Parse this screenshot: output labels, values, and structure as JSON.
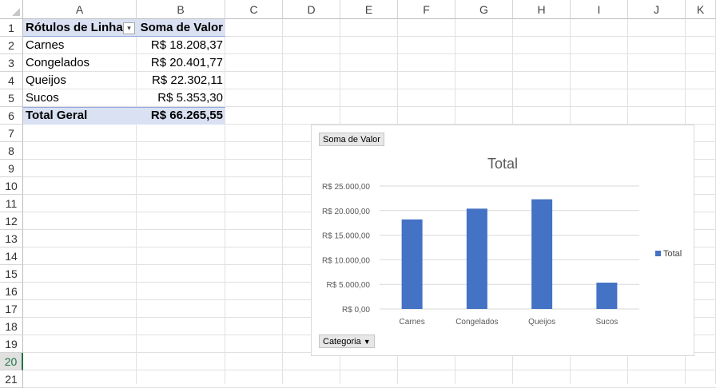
{
  "columns": [
    "A",
    "B",
    "C",
    "D",
    "E",
    "F",
    "G",
    "H",
    "I",
    "J",
    "K"
  ],
  "rows": [
    "1",
    "2",
    "3",
    "4",
    "5",
    "6",
    "7",
    "8",
    "9",
    "10",
    "11",
    "12",
    "13",
    "14",
    "15",
    "16",
    "17",
    "18",
    "19",
    "20",
    "21"
  ],
  "selected_row": "20",
  "pivot": {
    "header_label": "Rótulos de Linha",
    "header_value": "Soma de Valor",
    "items": [
      {
        "label": "Carnes",
        "value": "R$ 18.208,37"
      },
      {
        "label": "Congelados",
        "value": "R$ 20.401,77"
      },
      {
        "label": "Queijos",
        "value": "R$ 22.302,11"
      },
      {
        "label": "Sucos",
        "value": "R$ 5.353,30"
      }
    ],
    "total_label": "Total Geral",
    "total_value": "R$ 66.265,55",
    "filter_icon": "dropdown-arrow-icon"
  },
  "chart": {
    "value_field_button": "Soma de Valor",
    "axis_field_button": "Categoria",
    "colors": {
      "bar": "#4472c4",
      "grid": "#d9d9d9"
    }
  },
  "chart_data": {
    "type": "bar",
    "title": "Total",
    "categories": [
      "Carnes",
      "Congelados",
      "Queijos",
      "Sucos"
    ],
    "series": [
      {
        "name": "Total",
        "values": [
          18208.37,
          20401.77,
          22302.11,
          5353.3
        ]
      }
    ],
    "ylim": [
      0,
      25000
    ],
    "yticks": [
      0,
      5000,
      10000,
      15000,
      20000,
      25000
    ],
    "ytick_labels": [
      "R$ 0,00",
      "R$ 5.000,00",
      "R$ 10.000,00",
      "R$ 15.000,00",
      "R$ 20.000,00",
      "R$ 25.000,00"
    ],
    "grid": true,
    "legend": "right"
  }
}
